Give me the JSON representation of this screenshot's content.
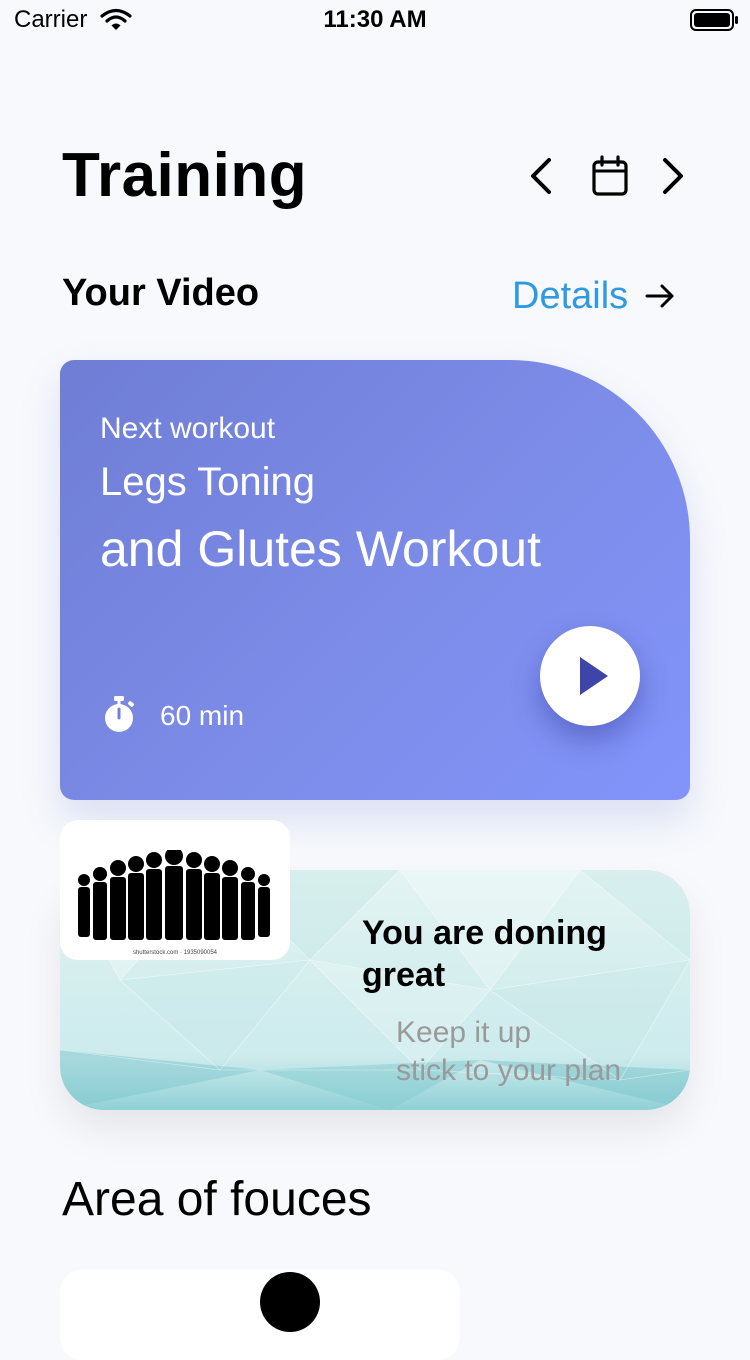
{
  "status_bar": {
    "carrier": "Carrier",
    "time": "11:30 AM"
  },
  "header": {
    "title": "Training"
  },
  "video_section": {
    "title": "Your Video",
    "details_label": "Details"
  },
  "workout_card": {
    "next_label": "Next workout",
    "title_line1": "Legs Toning",
    "title_line2": "and Glutes Workout",
    "duration": "60 min"
  },
  "motivation_card": {
    "title": "You are doning great",
    "message_line1": "Keep it up",
    "message_line2": "stick to your plan",
    "image_watermark": "shutterstock.com · 1935090054"
  },
  "focus_section": {
    "title": "Area of fouces"
  },
  "colors": {
    "accent": "#2f9ae3",
    "card_gradient_start": "#6f7dd5",
    "card_gradient_end": "#8294fb",
    "play_icon": "#3f44a8"
  },
  "icons": [
    "wifi-icon",
    "battery-icon",
    "chevron-left-icon",
    "calendar-icon",
    "chevron-right-icon",
    "arrow-right-icon",
    "stopwatch-icon",
    "play-icon"
  ]
}
